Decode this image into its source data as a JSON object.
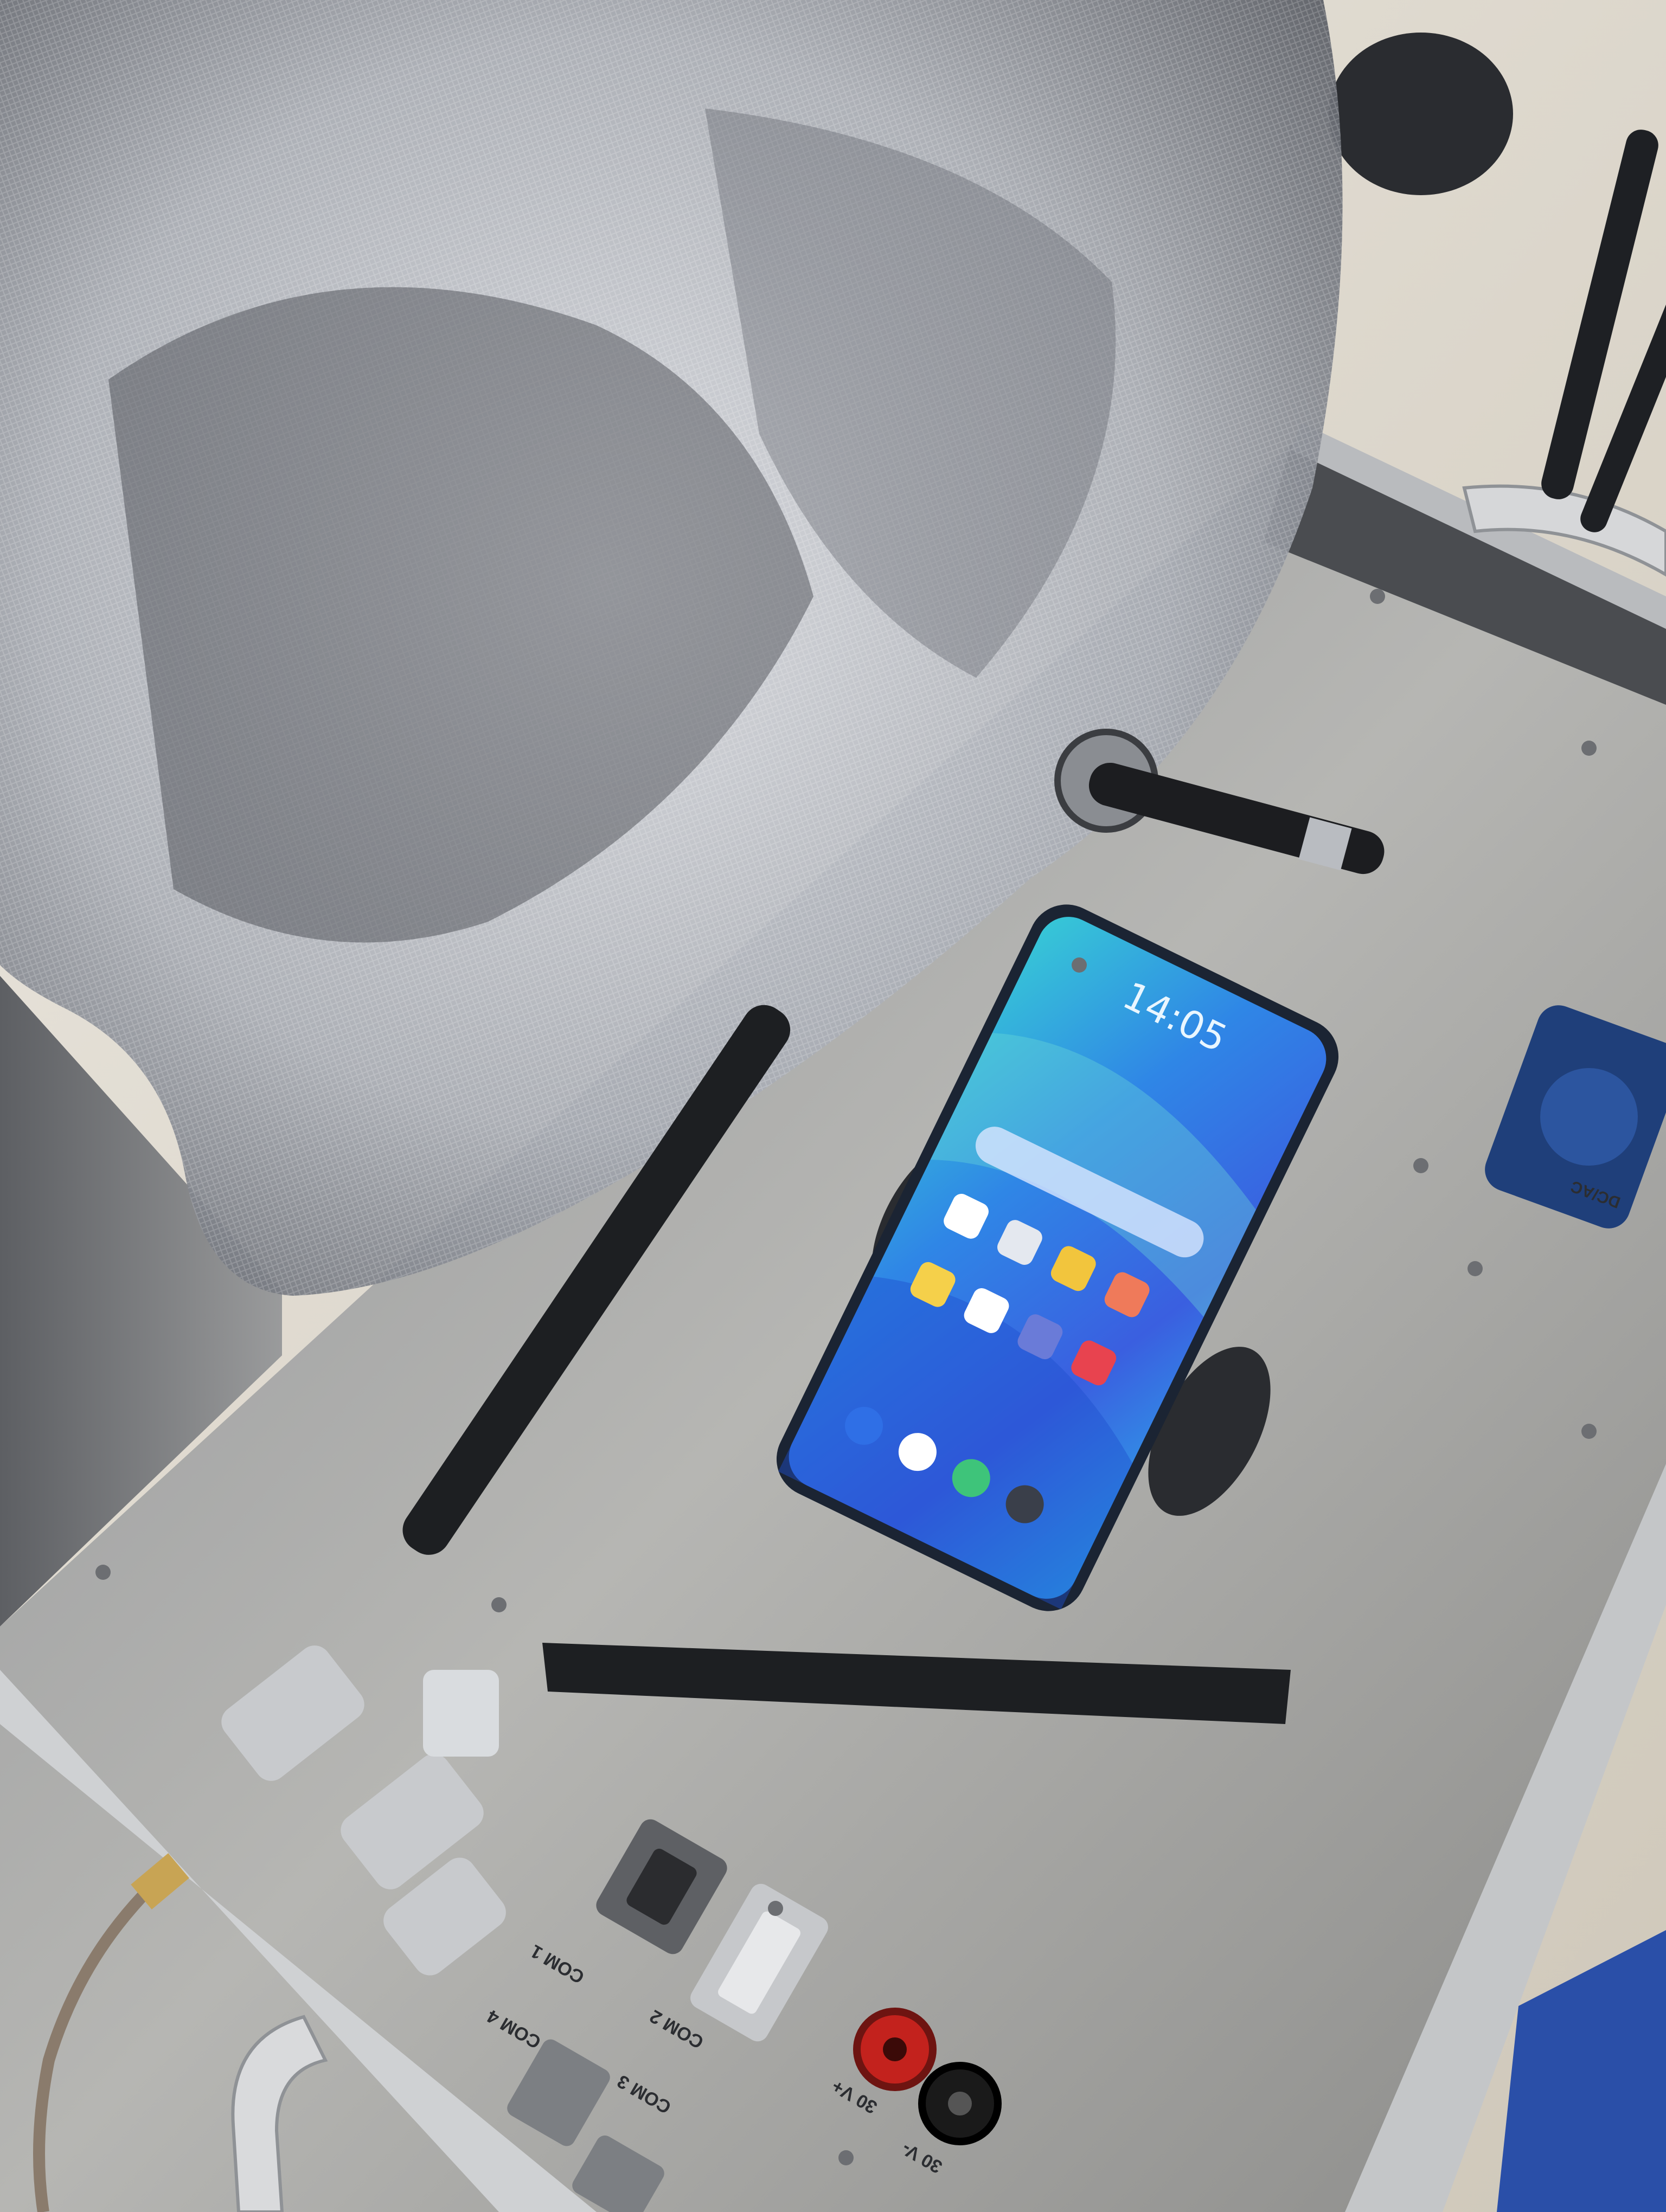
{
  "scene": {
    "description_title": "",
    "phone": {
      "clock": "14:05"
    },
    "panel_labels": {
      "com1": "COM 1",
      "com2": "COM 2",
      "com3": "COM 3",
      "com4": "COM 4",
      "dc_plus": "30 V+",
      "dc_minus": "30 V-",
      "jack_label": "DC/AC"
    },
    "colors": {
      "tray": "#a9a9a6",
      "tray_shadow": "#6e6f71",
      "mesh": "#c9ccd2",
      "phone_screen": "#2f7fe0",
      "antenna": "#1f2124",
      "red_terminal": "#c3221d",
      "black_terminal": "#1a1a1a",
      "blue_socket": "#1f3f7a",
      "floor": "#d9d3c6"
    }
  }
}
